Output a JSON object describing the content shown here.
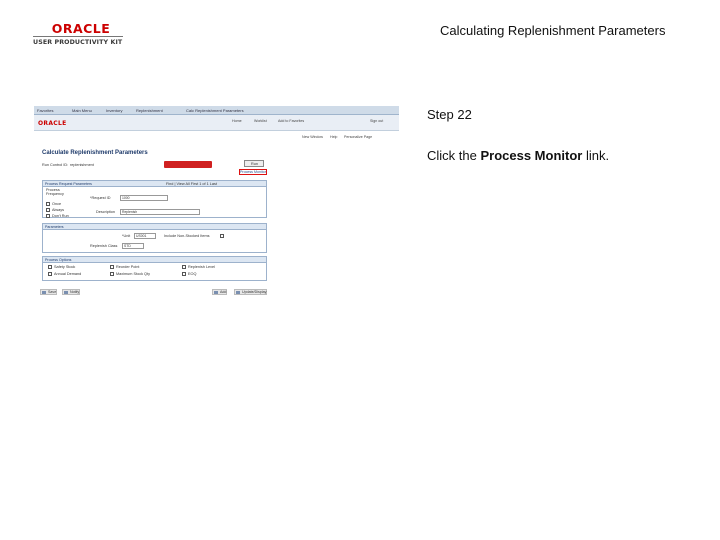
{
  "header": {
    "logo_brand": "ORACLE",
    "logo_product": "USER PRODUCTIVITY KIT",
    "slide_title": "Calculating Replenishment Parameters"
  },
  "step": {
    "label": "Step 22",
    "instruction_prefix": "Click the ",
    "instruction_target": "Process Monitor",
    "instruction_suffix": " link."
  },
  "screenshot": {
    "breadcrumb": [
      "Favorites",
      "Main Menu",
      "Inventory",
      "Replenishment",
      "Calc Replenishment Parameters"
    ],
    "brand": "ORACLE",
    "top_links": [
      "Home",
      "Worklist",
      "Add to Favorites",
      "Sign out"
    ],
    "sub_links": [
      "New Window",
      "Help",
      "Personalize Page"
    ],
    "page_title": "Calculate Replenishment Parameters",
    "run_control_label": "Run Control ID:",
    "run_control_value": "replenishment",
    "report_manager": "Report Manager",
    "run_button": "Run",
    "process_monitor_link": "Process Monitor",
    "process_section": "Process Request Parameters",
    "grid_nav": "Find | View All   First  1 of 1  Last",
    "process_frequency": "Process Frequency",
    "frequency_options": [
      "Once",
      "Always",
      "Don't Run"
    ],
    "request_id_label": "*Request ID",
    "request_id_value": "1000",
    "description_label": "Description",
    "description_value": "Replenish",
    "params_section": "Parameters",
    "unit_label": "*Unit",
    "unit_value": "US001",
    "replen_class_label": "Replenish Class",
    "replen_class_value": "STD",
    "include_label": "Include Non-Stocked Items",
    "options_section": "Process Options",
    "options": [
      "Safety Stock",
      "Annual Demand",
      "Reorder Point",
      "Maximum Stock Qty",
      "Replenish Level",
      "EOQ"
    ],
    "save_button": "Save",
    "notify_button": "Notify",
    "add_button": "Add",
    "update_button": "Update/Display"
  },
  "colors": {
    "oracle_red": "#cc0000",
    "highlight": "#d11111",
    "section_blue": "#dce6f2"
  }
}
